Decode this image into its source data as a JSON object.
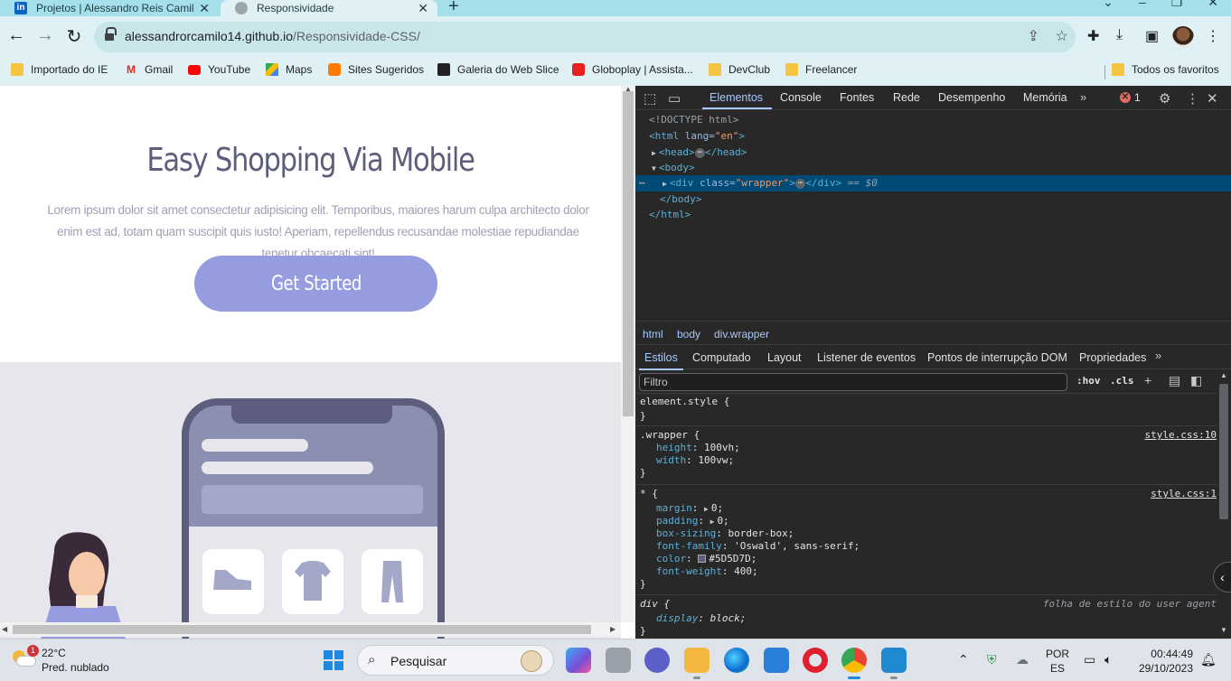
{
  "browser": {
    "tabs": [
      {
        "title": "Projetos | Alessandro Reis Camilo"
      },
      {
        "title": "Responsividade"
      }
    ],
    "url_host": "alessandrorcamilo14.github.io",
    "url_path": "/Responsividade-CSS/",
    "bookmarks": [
      "Importado do IE",
      "Gmail",
      "YouTube",
      "Maps",
      "Sites Sugeridos",
      "Galeria do Web Slice",
      "Globoplay | Assista...",
      "DevClub",
      "Freelancer"
    ],
    "all_bookmarks": "Todos os favoritos"
  },
  "page": {
    "title": "Easy Shopping Via Mobile",
    "description": "Lorem ipsum dolor sit amet consectetur adipisicing elit. Temporibus, maiores harum culpa architecto dolor enim est ad, totam quam suscipit quis iusto! Aperiam, repellendus recusandae molestiae repudiandae tenetur obcaecati sint!",
    "cta": "Get Started"
  },
  "devtools": {
    "tabs": [
      "Elementos",
      "Console",
      "Fontes",
      "Rede",
      "Desempenho",
      "Memória"
    ],
    "error_count": "1",
    "dom": {
      "doctype": "<!DOCTYPE html>",
      "html_open": "html",
      "lang_attr": "lang",
      "lang_val": "\"en\"",
      "head": "head",
      "body": "body",
      "div": "div",
      "class_attr": "class",
      "class_val": "\"wrapper\"",
      "sel_marker": "== $0"
    },
    "breadcrumbs": [
      "html",
      "body",
      "div.wrapper"
    ],
    "style_tabs": [
      "Estilos",
      "Computado",
      "Layout",
      "Listener de eventos",
      "Pontos de interrupção DOM",
      "Propriedades"
    ],
    "filter_placeholder": "Filtro",
    "hov": ":hov",
    "cls": ".cls",
    "rules": {
      "element_style": "element.style {",
      "wrapper_sel": ".wrapper {",
      "wrapper_src": "style.css:10",
      "wrapper_decls": [
        {
          "prop": "height",
          "val": "100vh;"
        },
        {
          "prop": "width",
          "val": "100vw;"
        }
      ],
      "star_sel": "* {",
      "star_src": "style.css:1",
      "star_decls": [
        {
          "prop": "margin",
          "val": "0;"
        },
        {
          "prop": "padding",
          "val": "0;"
        },
        {
          "prop": "box-sizing",
          "val": "border-box;"
        },
        {
          "prop": "font-family",
          "val": "'Oswald', sans-serif;"
        },
        {
          "prop": "color",
          "val": "#5D5D7D;"
        },
        {
          "prop": "font-weight",
          "val": "400;"
        }
      ],
      "div_sel": "div {",
      "div_src": "folha de estilo do user agent",
      "div_decl": {
        "prop": "display",
        "val": "block;"
      },
      "close": "}"
    },
    "colors": {
      "swatch": "#5D5D7D"
    }
  },
  "taskbar": {
    "weather_temp": "22°C",
    "weather_desc": "Pred. nublado",
    "weather_badge": "1",
    "search_label": "Pesquisar",
    "lang_line1": "POR",
    "lang_line2": "ES",
    "time": "00:44:49",
    "date": "29/10/2023"
  }
}
